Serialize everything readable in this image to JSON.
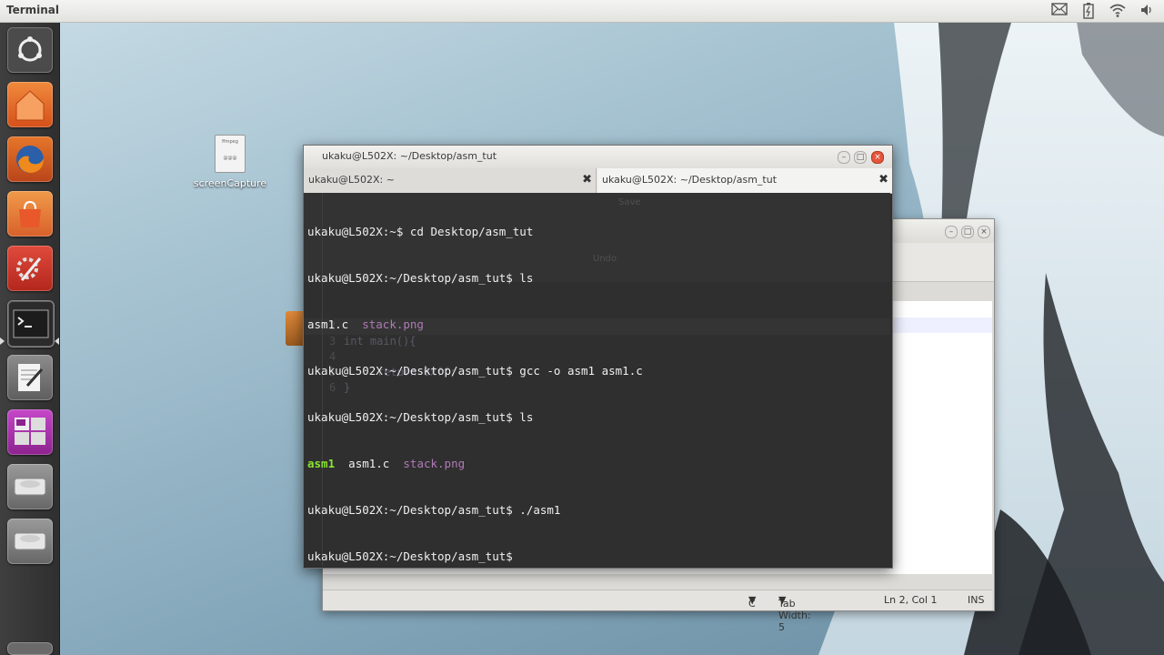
{
  "topbar": {
    "app_title": "Terminal"
  },
  "tray_icons": [
    "mail-icon",
    "battery-icon",
    "wifi-icon",
    "volume-icon"
  ],
  "launcher": {
    "items": [
      "ubuntu-dash-icon",
      "home-folder-icon",
      "firefox-icon",
      "software-center-icon",
      "system-settings-icon",
      "terminal-icon",
      "text-editor-icon",
      "workspace-switcher-icon",
      "drive-icon",
      "drive-icon-2",
      "trash-icon"
    ]
  },
  "desktop_icon": {
    "label": "screenCapture"
  },
  "terminal": {
    "title": "ukaku@L502X: ~/Desktop/asm_tut",
    "tabs": [
      {
        "label": "ukaku@L502X: ~"
      },
      {
        "label": "ukaku@L502X: ~/Desktop/asm_tut"
      }
    ],
    "lines": {
      "l1": "ukaku@L502X:~$ cd Desktop/asm_tut",
      "l2": "ukaku@L502X:~/Desktop/asm_tut$ ls",
      "l3_a": "asm1.c",
      "l3_b": "stack.png",
      "l4": "ukaku@L502X:~/Desktop/asm_tut$ gcc -o asm1 asm1.c",
      "l5": "ukaku@L502X:~/Desktop/asm_tut$ ls",
      "l6_a": "asm1",
      "l6_b": "asm1.c",
      "l6_c": "stack.png",
      "l7": "ukaku@L502X:~/Desktop/asm_tut$ ./asm1",
      "l8": "ukaku@L502X:~/Desktop/asm_tut$"
    }
  },
  "gedit": {
    "toolbar": {
      "save": "Save",
      "undo": "Undo"
    },
    "code": {
      "ln2": "2",
      "ln3": "3",
      "ln4": "4",
      "ln5": "5",
      "ln6": "6",
      "c3": "int main(){",
      "c5": "    return 0xff;",
      "c6": "}"
    },
    "statusbar": {
      "language": "C",
      "tab_width": "Tab Width:  5",
      "position": "Ln 2, Col 1",
      "mode": "INS"
    }
  },
  "colors": {
    "launcher_bg": "#333333",
    "terminal_bg": "#2f2f2f",
    "png_file": "#b07ab7",
    "executable": "#8ae234"
  }
}
